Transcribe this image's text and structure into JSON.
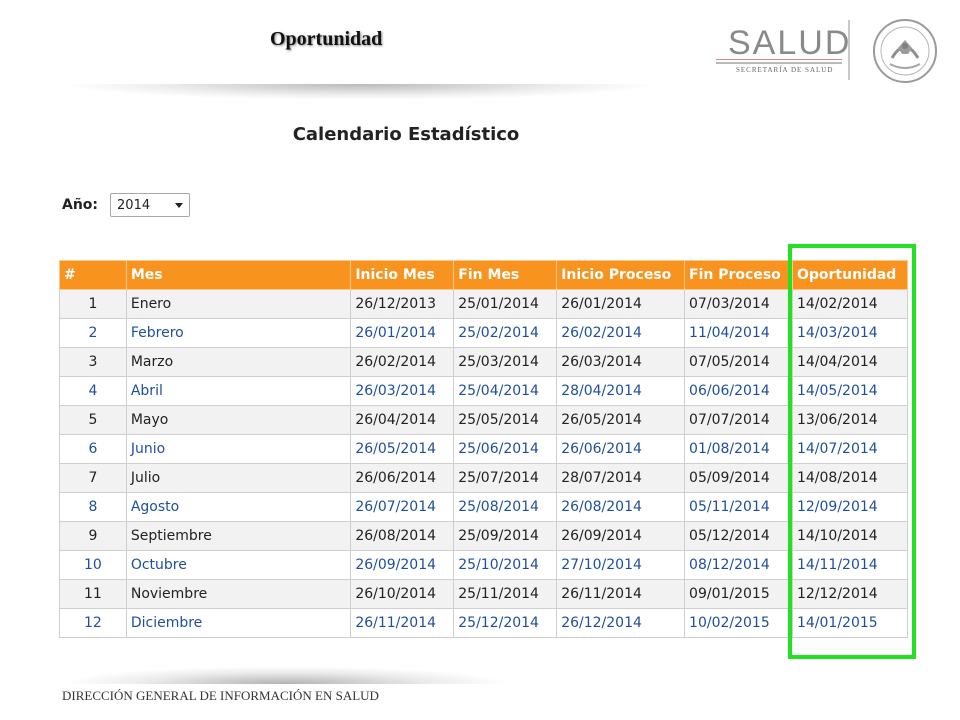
{
  "header": {
    "title": "Oportunidad",
    "logo_text": "SALUD",
    "logo_subtext": "SECRETARÍA DE SALUD"
  },
  "page": {
    "heading": "Calendario Estadístico"
  },
  "year_filter": {
    "label": "Año:",
    "selected": "2014"
  },
  "table": {
    "columns": [
      "#",
      "Mes",
      "Inicio Mes",
      "Fin Mes",
      "Inicio Proceso",
      "Fin Proceso",
      "Oportunidad"
    ],
    "rows": [
      [
        "1",
        "Enero",
        "26/12/2013",
        "25/01/2014",
        "26/01/2014",
        "07/03/2014",
        "14/02/2014"
      ],
      [
        "2",
        "Febrero",
        "26/01/2014",
        "25/02/2014",
        "26/02/2014",
        "11/04/2014",
        "14/03/2014"
      ],
      [
        "3",
        "Marzo",
        "26/02/2014",
        "25/03/2014",
        "26/03/2014",
        "07/05/2014",
        "14/04/2014"
      ],
      [
        "4",
        "Abril",
        "26/03/2014",
        "25/04/2014",
        "28/04/2014",
        "06/06/2014",
        "14/05/2014"
      ],
      [
        "5",
        "Mayo",
        "26/04/2014",
        "25/05/2014",
        "26/05/2014",
        "07/07/2014",
        "13/06/2014"
      ],
      [
        "6",
        "Junio",
        "26/05/2014",
        "25/06/2014",
        "26/06/2014",
        "01/08/2014",
        "14/07/2014"
      ],
      [
        "7",
        "Julio",
        "26/06/2014",
        "25/07/2014",
        "28/07/2014",
        "05/09/2014",
        "14/08/2014"
      ],
      [
        "8",
        "Agosto",
        "26/07/2014",
        "25/08/2014",
        "26/08/2014",
        "05/11/2014",
        "12/09/2014"
      ],
      [
        "9",
        "Septiembre",
        "26/08/2014",
        "25/09/2014",
        "26/09/2014",
        "05/12/2014",
        "14/10/2014"
      ],
      [
        "10",
        "Octubre",
        "26/09/2014",
        "25/10/2014",
        "27/10/2014",
        "08/12/2014",
        "14/11/2014"
      ],
      [
        "11",
        "Noviembre",
        "26/10/2014",
        "25/11/2014",
        "26/11/2014",
        "09/01/2015",
        "12/12/2014"
      ],
      [
        "12",
        "Diciembre",
        "26/11/2014",
        "25/12/2014",
        "26/12/2014",
        "10/02/2015",
        "14/01/2015"
      ]
    ]
  },
  "footer": {
    "text": "DIRECCIÓN GENERAL DE INFORMACIÓN EN SALUD"
  },
  "colors": {
    "header_orange": "#f7931e",
    "highlight_green": "#22e022",
    "link_blue": "#1f4f9a"
  }
}
